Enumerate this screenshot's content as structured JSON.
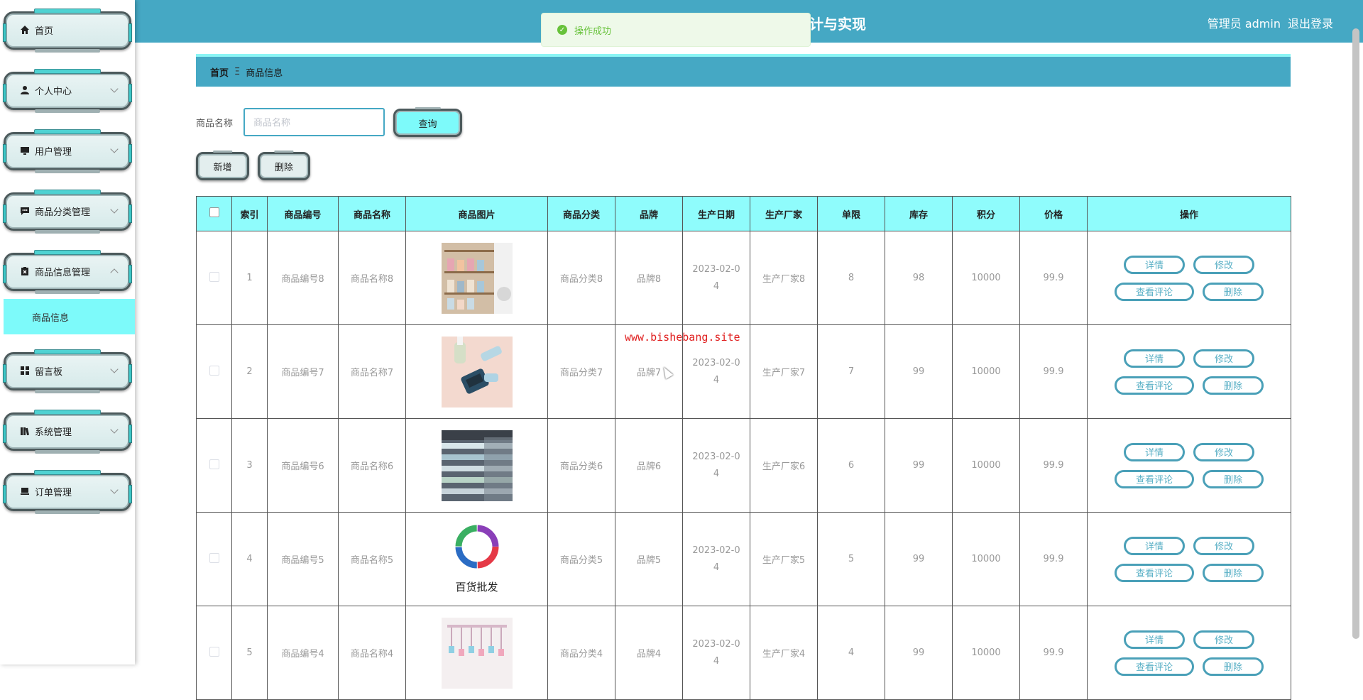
{
  "sidebar": {
    "items": [
      {
        "label": "首页",
        "icon": "home-icon",
        "has_chevron": false
      },
      {
        "label": "个人中心",
        "icon": "user-icon",
        "has_chevron": true
      },
      {
        "label": "用户管理",
        "icon": "monitor-icon",
        "has_chevron": true
      },
      {
        "label": "商品分类管理",
        "icon": "chat-icon",
        "has_chevron": true
      },
      {
        "label": "商品信息管理",
        "icon": "clipboard-icon",
        "has_chevron": true,
        "expanded": true
      },
      {
        "label": "留言板",
        "icon": "grid-icon",
        "has_chevron": true
      },
      {
        "label": "系统管理",
        "icon": "books-icon",
        "has_chevron": true
      },
      {
        "label": "订单管理",
        "icon": "cart-icon",
        "has_chevron": true
      }
    ],
    "active_submenu": "商品信息"
  },
  "header": {
    "title": "计与实现",
    "user_label": "管理员 admin",
    "logout_label": "退出登录"
  },
  "toast": {
    "message": "操作成功"
  },
  "breadcrumb": {
    "home": "首页",
    "separator": "Ξ",
    "current": "商品信息"
  },
  "search": {
    "label": "商品名称",
    "placeholder": "商品名称",
    "value": "",
    "query_button": "查询"
  },
  "actions": {
    "add_button": "新增",
    "delete_button": "删除"
  },
  "table": {
    "headers": [
      "索引",
      "商品编号",
      "商品名称",
      "商品图片",
      "商品分类",
      "品牌",
      "生产日期",
      "生产厂家",
      "单限",
      "库存",
      "积分",
      "价格",
      "操作"
    ],
    "rows": [
      {
        "index": "1",
        "code": "商品编号8",
        "name": "商品名称8",
        "image": "shelf-photo",
        "category": "商品分类8",
        "brand": "品牌8",
        "date": "2023-02-04",
        "maker": "生产厂家8",
        "limit": "8",
        "stock": "98",
        "points": "10000",
        "price": "99.9"
      },
      {
        "index": "2",
        "code": "商品编号7",
        "name": "商品名称7",
        "image": "brush-photo",
        "category": "商品分类7",
        "brand": "品牌7",
        "date": "2023-02-04",
        "maker": "生产厂家7",
        "limit": "7",
        "stock": "99",
        "points": "10000",
        "price": "99.9"
      },
      {
        "index": "3",
        "code": "商品编号6",
        "name": "商品名称6",
        "image": "aisle-photo",
        "category": "商品分类6",
        "brand": "品牌6",
        "date": "2023-02-04",
        "maker": "生产厂家6",
        "limit": "6",
        "stock": "99",
        "points": "10000",
        "price": "99.9"
      },
      {
        "index": "4",
        "code": "商品编号5",
        "name": "商品名称5",
        "image": "logo-photo",
        "image_caption": "百货批发",
        "category": "商品分类5",
        "brand": "品牌5",
        "date": "2023-02-04",
        "maker": "生产厂家5",
        "limit": "5",
        "stock": "99",
        "points": "10000",
        "price": "99.9"
      },
      {
        "index": "5",
        "code": "商品编号4",
        "name": "商品名称4",
        "image": "hanger-photo",
        "category": "商品分类4",
        "brand": "品牌4",
        "date": "2023-02-04",
        "maker": "生产厂家4",
        "limit": "4",
        "stock": "99",
        "points": "10000",
        "price": "99.9"
      }
    ],
    "row_buttons": {
      "detail": "详情",
      "edit": "修改",
      "reviews": "查看评论",
      "delete": "删除"
    }
  },
  "watermark": "www.bishebang.site",
  "colors": {
    "header": "#45a8c4",
    "accent": "#7dfafa",
    "table_head": "#8ffcfc",
    "success": "#67c23a"
  }
}
